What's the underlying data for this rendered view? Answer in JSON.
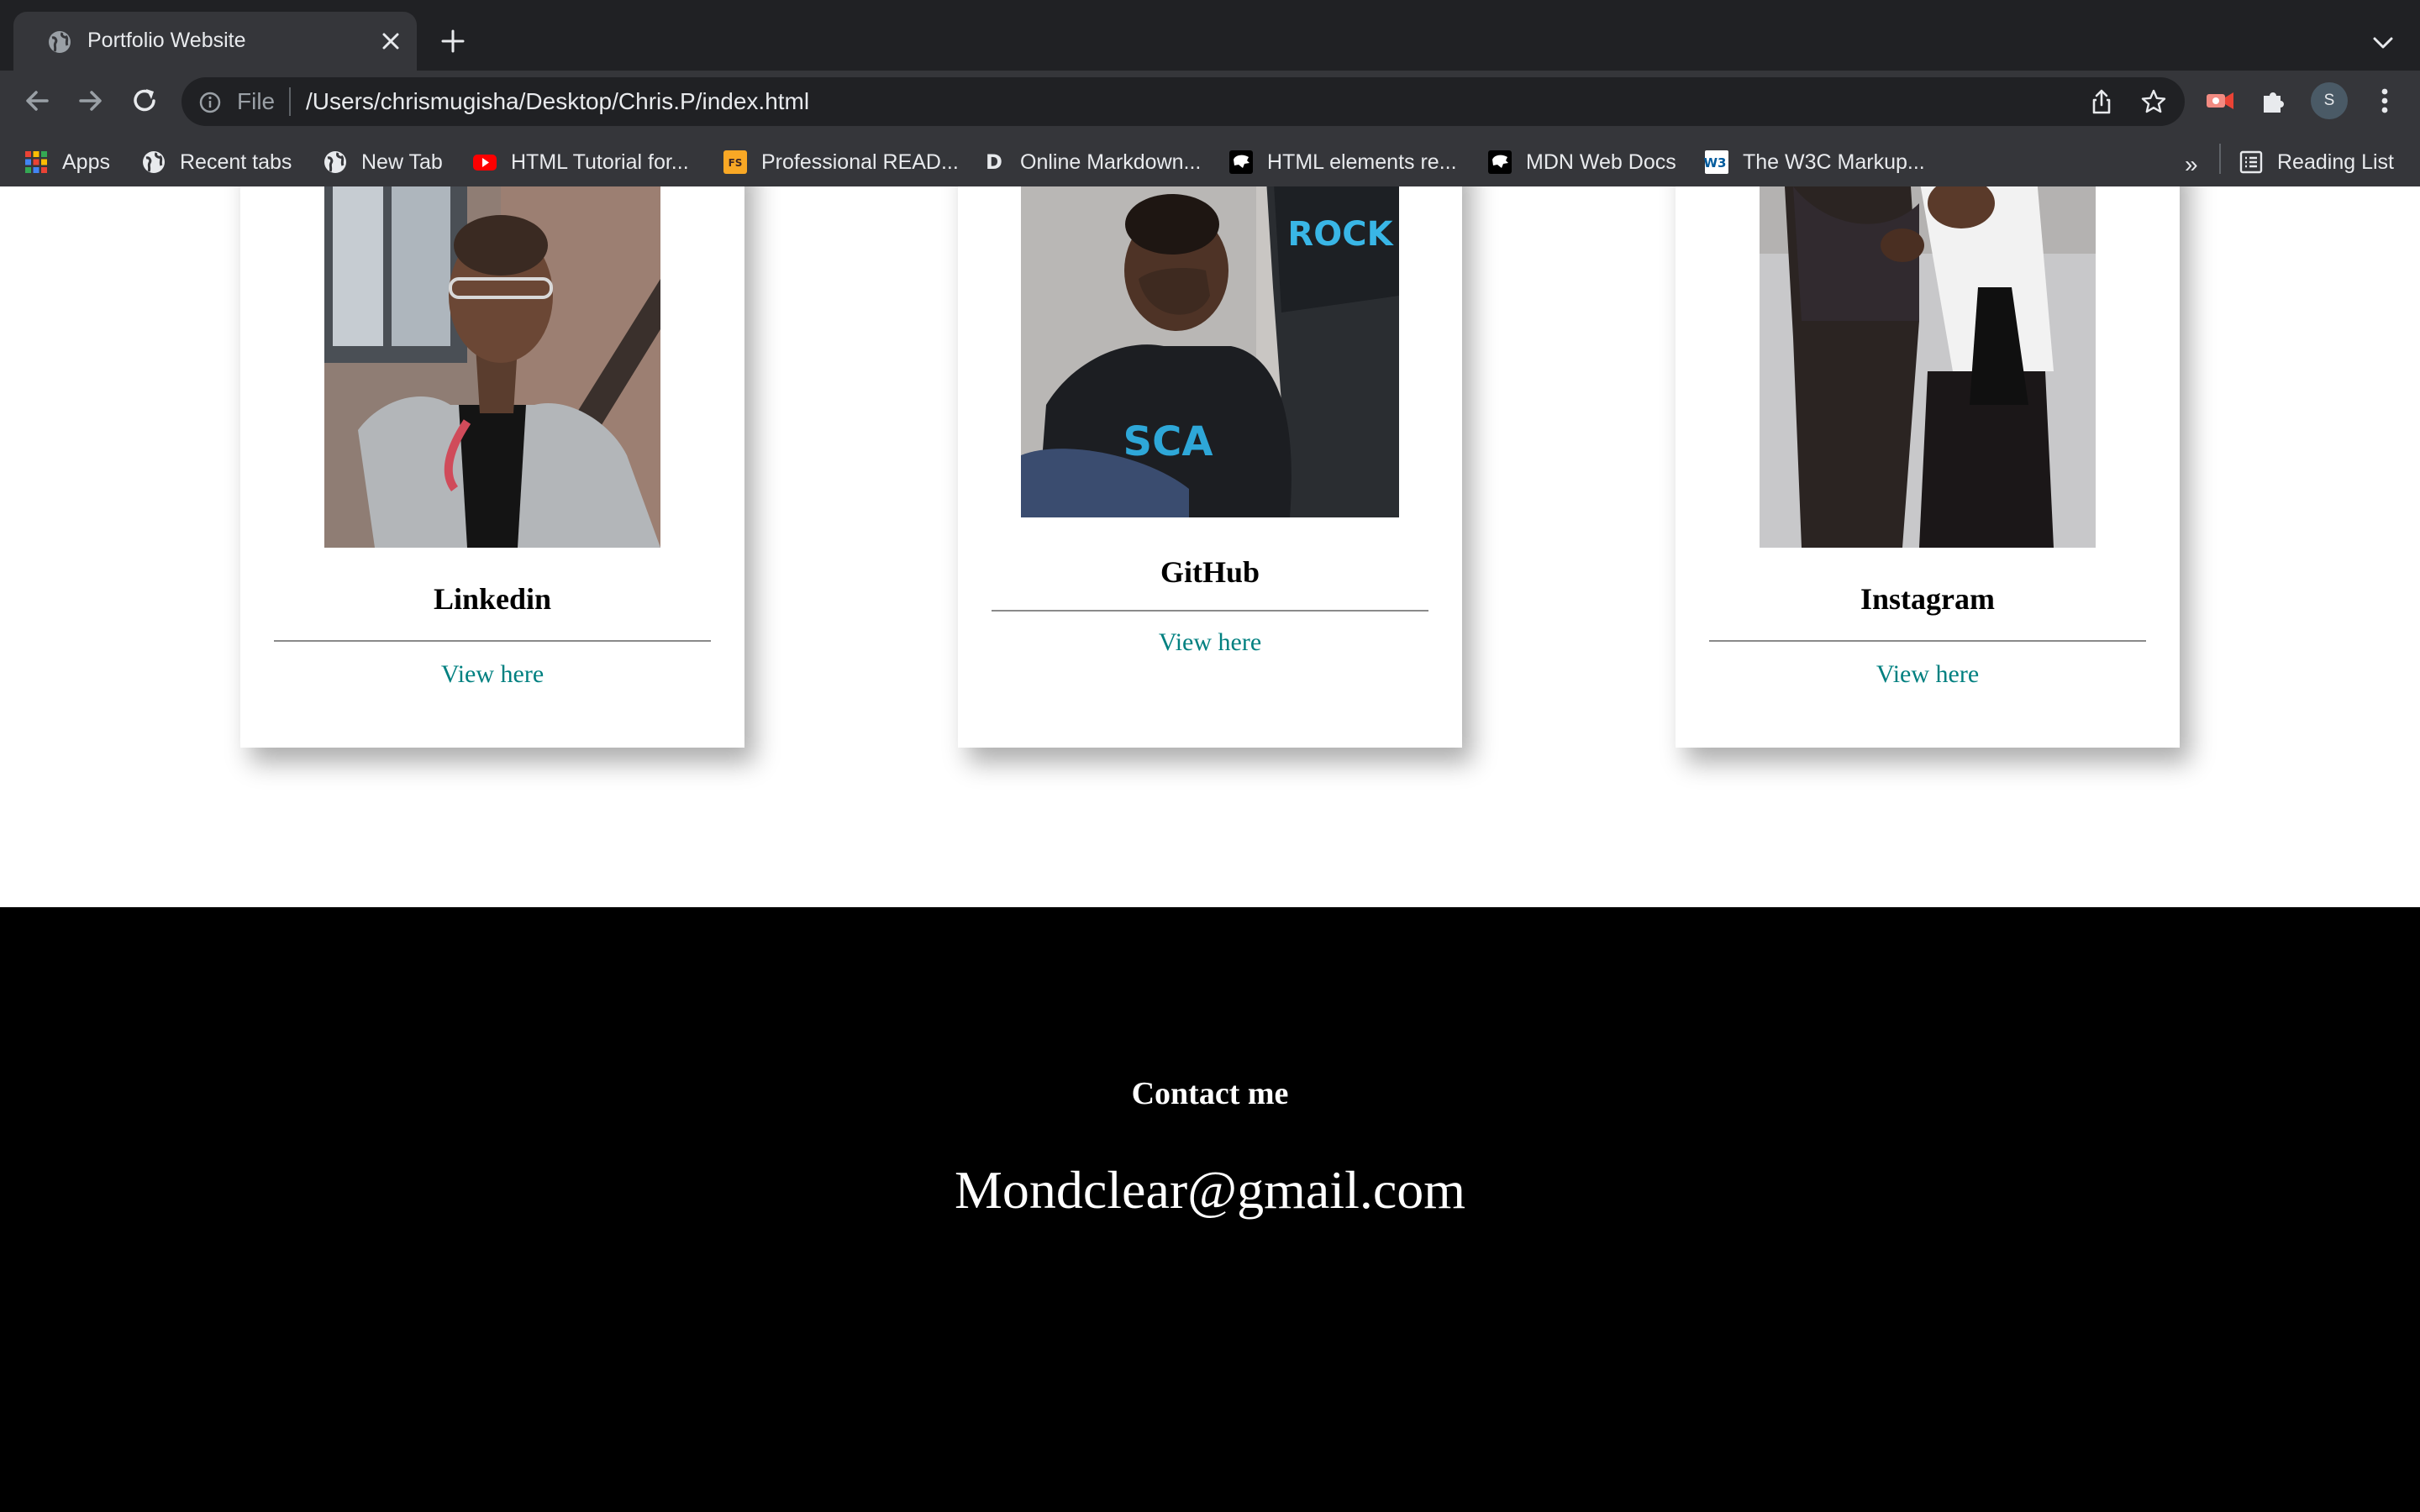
{
  "browser": {
    "tab_title": "Portfolio Website",
    "scheme_label": "File",
    "url": "/Users/chrismugisha/Desktop/Chris.P/index.html",
    "profile_initial": "S",
    "bookmarks": [
      {
        "label": "Apps",
        "icon": "apps-grid-icon"
      },
      {
        "label": "Recent tabs",
        "icon": "globe-icon"
      },
      {
        "label": "New Tab",
        "icon": "globe-icon"
      },
      {
        "label": "HTML Tutorial for...",
        "icon": "youtube-icon"
      },
      {
        "label": "Professional READ...",
        "icon": "fs-icon"
      },
      {
        "label": "Online Markdown...",
        "icon": "d-icon"
      },
      {
        "label": "HTML elements re...",
        "icon": "mdn-icon"
      },
      {
        "label": "MDN Web Docs",
        "icon": "mdn-icon"
      },
      {
        "label": "The W3C Markup...",
        "icon": "w3c-icon"
      }
    ],
    "bookmarks_overflow": "»",
    "reading_list": "Reading List"
  },
  "cards": [
    {
      "title": "Linkedin",
      "link": "View here"
    },
    {
      "title": "GitHub",
      "link": "View here"
    },
    {
      "title": "Instagram",
      "link": "View here"
    }
  ],
  "footer": {
    "heading": "Contact me",
    "email": "Mondclear@gmail.com"
  },
  "colors": {
    "link": "#008080",
    "footer_bg": "#000000",
    "chrome_bg": "#35363a",
    "tabstrip_bg": "#202124"
  }
}
